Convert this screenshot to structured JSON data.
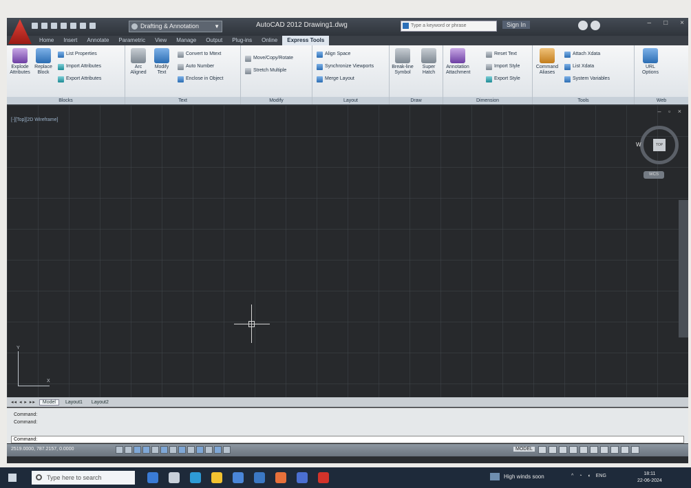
{
  "window": {
    "title": "AutoCAD 2012   Drawing1.dwg",
    "workspace": "Drafting & Annotation",
    "search_placeholder": "Type a keyword or phrase",
    "sign_in": "Sign In"
  },
  "ribbon_tabs": [
    "Home",
    "Insert",
    "Annotate",
    "Parametric",
    "View",
    "Manage",
    "Output",
    "Plug-ins",
    "Online",
    "Express Tools"
  ],
  "active_tab": "Express Tools",
  "panels": {
    "blocks": {
      "title": "Blocks",
      "explode": "Explode Attributes",
      "replace": "Replace Block",
      "list_props": "List Properties",
      "import_attr": "Import Attributes",
      "export_attr": "Export Attributes"
    },
    "text": {
      "title": "Text",
      "arc_aligned": "Arc Aligned",
      "modify_text": "Modify Text",
      "convert": "Convert to Mtext",
      "auto_number": "Auto Number",
      "enclose": "Enclose in Object"
    },
    "modify": {
      "title": "Modify",
      "move_copy": "Move/Copy/Rotate",
      "stretch": "Stretch Multiple"
    },
    "layout": {
      "title": "Layout",
      "align_space": "Align Space",
      "sync": "Synchronize Viewports",
      "merge": "Merge Layout"
    },
    "draw": {
      "title": "Draw",
      "break_line": "Break-line Symbol",
      "super_hatch": "Super Hatch"
    },
    "dimension": {
      "title": "Dimension",
      "annotation": "Annotation Attachment",
      "reset_text": "Reset Text",
      "import_style": "Import Style",
      "export_style": "Export Style"
    },
    "tools": {
      "title": "Tools",
      "command_aliases": "Command Aliases",
      "attach_xdata": "Attach Xdata",
      "list_xdata": "List Xdata",
      "system_vars": "System Variables"
    },
    "web": {
      "title": "Web",
      "url_options": "URL Options"
    }
  },
  "drawing": {
    "viewport_label": "[-][Top][2D Wireframe]",
    "viewcube_face": "TOP",
    "viewcube_w": "W",
    "wcs": "WCS",
    "ucs_x": "X",
    "ucs_y": "Y"
  },
  "layout_tabs": [
    "Model",
    "Layout1",
    "Layout2"
  ],
  "command": {
    "line1": "Command:",
    "line2": "Command:",
    "prompt": "Command:"
  },
  "status": {
    "coords": "2519.0000, 787.2157, 0.0000",
    "model": "MODEL"
  },
  "taskbar": {
    "search": "Type here to search",
    "weather": "High winds soon",
    "lang": "ENG",
    "time": "18:11",
    "date": "22-06-2024"
  }
}
